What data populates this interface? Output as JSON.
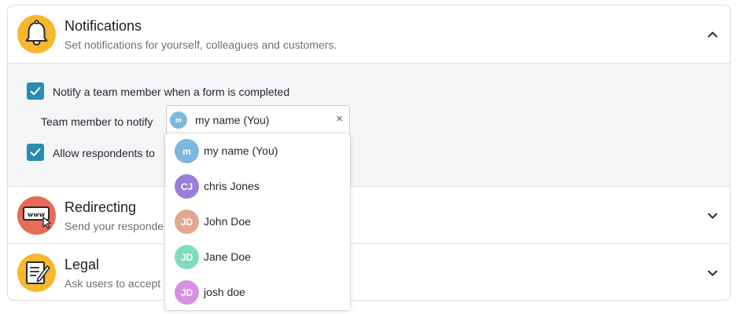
{
  "notifications": {
    "title": "Notifications",
    "description": "Set notifications for yourself, colleagues and customers.",
    "icon": "bell-icon",
    "expanded": true,
    "notify_checkbox_label": "Notify a team member when a form is completed",
    "notify_checked": true,
    "team_member_label": "Team member to notify",
    "selected_member": {
      "initials": "m",
      "name": "my name (You)",
      "color": "#7cb7dd"
    },
    "clear_symbol": "×",
    "respondents_checkbox_label": "Allow respondents to",
    "respondents_checked": true
  },
  "redirecting": {
    "title": "Redirecting",
    "description": "Send your responde",
    "icon": "www-redirect-icon"
  },
  "legal": {
    "title": "Legal",
    "description": "Ask users to accept",
    "icon": "legal-document-icon"
  },
  "dropdown": {
    "options": [
      {
        "initials": "m",
        "name": "my name (You)",
        "color": "#7cb7dd"
      },
      {
        "initials": "CJ",
        "name": "chris Jones",
        "color": "#9a7fd9"
      },
      {
        "initials": "JD",
        "name": "John Doe",
        "color": "#e0a98f"
      },
      {
        "initials": "JD",
        "name": "Jane Doe",
        "color": "#7fdcbf"
      },
      {
        "initials": "JD",
        "name": "josh doe",
        "color": "#d891e0"
      }
    ]
  },
  "colors": {
    "accent": "#2b8bb0",
    "icon_yellow": "#f7b830",
    "icon_red": "#e86b55"
  }
}
